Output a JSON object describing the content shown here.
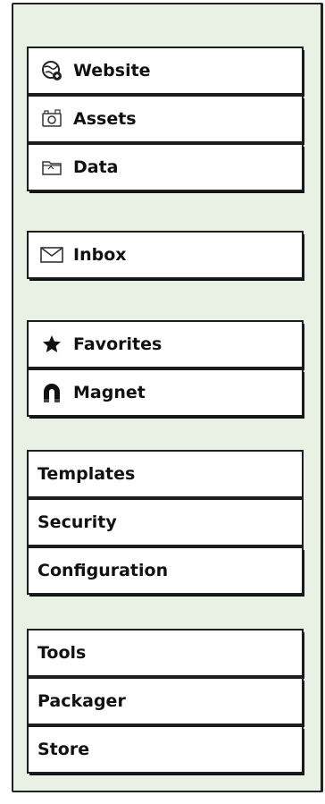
{
  "groups": [
    {
      "items": [
        {
          "label": "Website",
          "icon": "globe-icon"
        },
        {
          "label": "Assets",
          "icon": "camera-icon"
        },
        {
          "label": "Data",
          "icon": "folder-icon"
        }
      ]
    },
    {
      "items": [
        {
          "label": "Inbox",
          "icon": "envelope-icon"
        }
      ]
    },
    {
      "items": [
        {
          "label": "Favorites",
          "icon": "star-icon"
        },
        {
          "label": "Magnet",
          "icon": "magnet-icon"
        }
      ]
    },
    {
      "items": [
        {
          "label": "Templates"
        },
        {
          "label": "Security"
        },
        {
          "label": "Configuration"
        }
      ]
    },
    {
      "items": [
        {
          "label": "Tools"
        },
        {
          "label": "Packager"
        },
        {
          "label": "Store"
        }
      ]
    }
  ]
}
